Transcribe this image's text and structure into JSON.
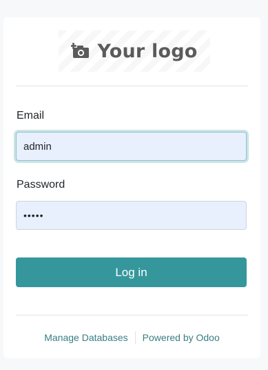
{
  "logo": {
    "text": "Your logo",
    "icon": "camera-plus-icon"
  },
  "form": {
    "email_label": "Email",
    "email_value": "admin",
    "password_label": "Password",
    "password_value": "admin",
    "login_label": "Log in"
  },
  "footer": {
    "manage_databases": "Manage Databases",
    "powered_by": "Powered by Odoo"
  },
  "colors": {
    "primary": "#35979c",
    "link": "#3a7d83",
    "input_bg": "#e8f0fe",
    "logo_text": "#5b5b5b"
  }
}
